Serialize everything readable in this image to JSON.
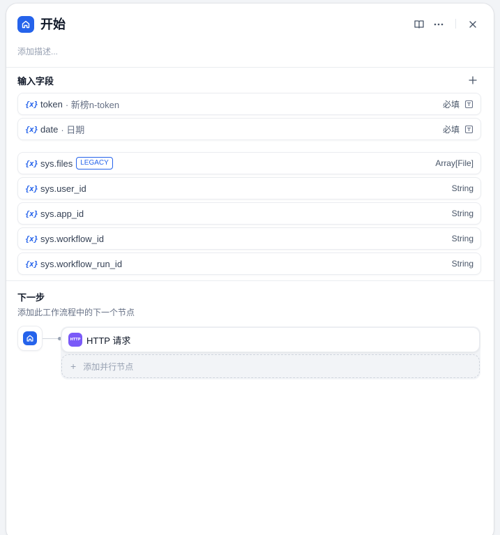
{
  "header": {
    "title": "开始",
    "description_placeholder": "添加描述...",
    "icons": [
      "home-icon",
      "book-icon",
      "more-icon",
      "close-icon"
    ]
  },
  "input_fields": {
    "title": "输入字段",
    "add_icon": "plus-icon",
    "items": [
      {
        "icon": "{x}",
        "name": "token",
        "label": "· 新榜n-token",
        "right": "必填",
        "right_icon": "text-input-icon"
      },
      {
        "icon": "{x}",
        "name": "date",
        "label": "· 日期",
        "right": "必填",
        "right_icon": "text-input-icon"
      }
    ]
  },
  "system_fields": {
    "items": [
      {
        "icon": "{x}",
        "name": "sys.files",
        "badge": "LEGACY",
        "type": "Array[File]"
      },
      {
        "icon": "{x}",
        "name": "sys.user_id",
        "type": "String"
      },
      {
        "icon": "{x}",
        "name": "sys.app_id",
        "type": "String"
      },
      {
        "icon": "{x}",
        "name": "sys.workflow_id",
        "type": "String"
      },
      {
        "icon": "{x}",
        "name": "sys.workflow_run_id",
        "type": "String"
      }
    ]
  },
  "next_step": {
    "title": "下一步",
    "subtitle": "添加此工作流程中的下一个节点",
    "node": {
      "badge": "HTTP",
      "label": "HTTP 请求"
    },
    "add_parallel": "添加并行节点"
  },
  "colors": {
    "accent": "#2563eb",
    "http_badge": "#7a5af8"
  }
}
